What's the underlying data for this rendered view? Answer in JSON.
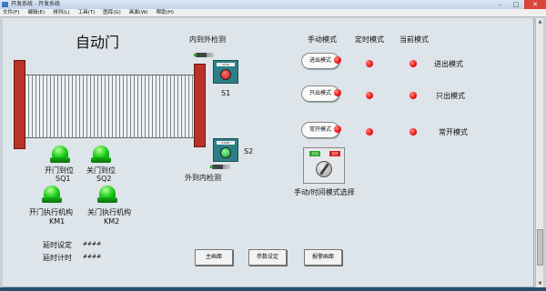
{
  "window": {
    "title": "开发系统 - 开发系统",
    "menu": [
      "文件(F)",
      "编辑(E)",
      "排列(L)",
      "工具(T)",
      "图库(G)",
      "画面(W)",
      "帮助(H)"
    ]
  },
  "screen": {
    "title": "自动门",
    "door": {
      "open_lamp_label": "开门到位",
      "open_lamp_tag": "SQ1",
      "close_lamp_label": "关门到位",
      "close_lamp_tag": "SQ2",
      "open_act_label": "开门执行机构",
      "open_act_tag": "KM1",
      "close_act_label": "关门执行机构",
      "close_act_tag": "KM2"
    },
    "sensors": {
      "inner_label": "内到外检测",
      "outer_label": "外到内检测",
      "s1_label": "S1",
      "s2_label": "S2",
      "s1_plate": "STOP",
      "s2_plate": "START"
    },
    "timers": {
      "delay_set_label": "延时设定",
      "delay_set_value": "####",
      "delay_timer_label": "延时计时",
      "delay_timer_value": "####"
    },
    "modes": {
      "col_manual": "手动模式",
      "col_timed": "定时模式",
      "col_current": "当前模式",
      "buttons": [
        "进出模式",
        "只出模式",
        "常开模式"
      ],
      "current": [
        "进出模式",
        "只出模式",
        "常开模式"
      ],
      "selector_label": "手动/时间模式选择",
      "selector_left": "手动",
      "selector_right": "定时"
    },
    "nav": {
      "main": "主画面",
      "params": "参数设定",
      "alarm": "报警画面"
    }
  },
  "colors": {
    "indicator": "#ee1010",
    "lamp": "#20d11c",
    "pillar": "#b8322a",
    "panel": "#dde4ea"
  }
}
